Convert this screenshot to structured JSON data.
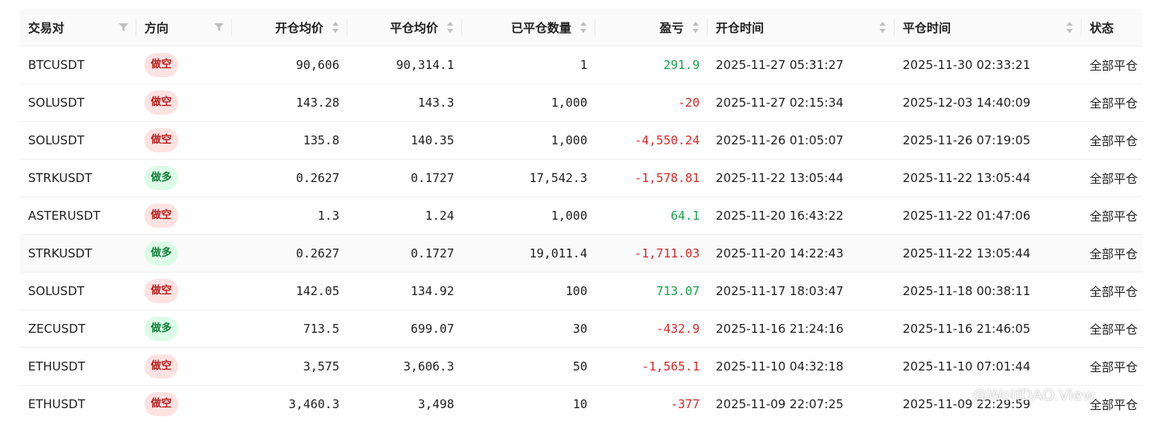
{
  "headers": {
    "pair": "交易对",
    "direction": "方向",
    "open_avg": "开仓均价",
    "close_avg": "平仓均价",
    "closed_qty": "已平仓数量",
    "pnl": "盈亏",
    "open_time": "开仓时间",
    "close_time": "平仓时间",
    "status": "状态"
  },
  "rows": [
    {
      "pair": "BTCUSDT",
      "direction": "做空",
      "side": "short",
      "open_avg": "90,606",
      "close_avg": "90,314.1",
      "closed_qty": "1",
      "pnl": "291.9",
      "pnl_sign": "pos",
      "open_time": "2025-11-27 05:31:27",
      "close_time": "2025-11-30 02:33:21",
      "status": "全部平仓"
    },
    {
      "pair": "SOLUSDT",
      "direction": "做空",
      "side": "short",
      "open_avg": "143.28",
      "close_avg": "143.3",
      "closed_qty": "1,000",
      "pnl": "-20",
      "pnl_sign": "neg",
      "open_time": "2025-11-27 02:15:34",
      "close_time": "2025-12-03 14:40:09",
      "status": "全部平仓"
    },
    {
      "pair": "SOLUSDT",
      "direction": "做空",
      "side": "short",
      "open_avg": "135.8",
      "close_avg": "140.35",
      "closed_qty": "1,000",
      "pnl": "-4,550.24",
      "pnl_sign": "neg",
      "open_time": "2025-11-26 01:05:07",
      "close_time": "2025-11-26 07:19:05",
      "status": "全部平仓"
    },
    {
      "pair": "STRKUSDT",
      "direction": "做多",
      "side": "long",
      "open_avg": "0.2627",
      "close_avg": "0.1727",
      "closed_qty": "17,542.3",
      "pnl": "-1,578.81",
      "pnl_sign": "neg",
      "open_time": "2025-11-22 13:05:44",
      "close_time": "2025-11-22 13:05:44",
      "status": "全部平仓"
    },
    {
      "pair": "ASTERUSDT",
      "direction": "做空",
      "side": "short",
      "open_avg": "1.3",
      "close_avg": "1.24",
      "closed_qty": "1,000",
      "pnl": "64.1",
      "pnl_sign": "pos",
      "open_time": "2025-11-20 16:43:22",
      "close_time": "2025-11-22 01:47:06",
      "status": "全部平仓"
    },
    {
      "pair": "STRKUSDT",
      "direction": "做多",
      "side": "long",
      "open_avg": "0.2627",
      "close_avg": "0.1727",
      "closed_qty": "19,011.4",
      "pnl": "-1,711.03",
      "pnl_sign": "neg",
      "open_time": "2025-11-20 14:22:43",
      "close_time": "2025-11-22 13:05:44",
      "status": "全部平仓",
      "hovered": true
    },
    {
      "pair": "SOLUSDT",
      "direction": "做空",
      "side": "short",
      "open_avg": "142.05",
      "close_avg": "134.92",
      "closed_qty": "100",
      "pnl": "713.07",
      "pnl_sign": "pos",
      "open_time": "2025-11-17 18:03:47",
      "close_time": "2025-11-18 00:38:11",
      "status": "全部平仓"
    },
    {
      "pair": "ZECUSDT",
      "direction": "做多",
      "side": "long",
      "open_avg": "713.5",
      "close_avg": "699.07",
      "closed_qty": "30",
      "pnl": "-432.9",
      "pnl_sign": "neg",
      "open_time": "2025-11-16 21:24:16",
      "close_time": "2025-11-16 21:46:05",
      "status": "全部平仓"
    },
    {
      "pair": "ETHUSDT",
      "direction": "做空",
      "side": "short",
      "open_avg": "3,575",
      "close_avg": "3,606.3",
      "closed_qty": "50",
      "pnl": "-1,565.1",
      "pnl_sign": "neg",
      "open_time": "2025-11-10 04:32:18",
      "close_time": "2025-11-10 07:01:44",
      "status": "全部平仓"
    },
    {
      "pair": "ETHUSDT",
      "direction": "做空",
      "side": "short",
      "open_avg": "3,460.3",
      "close_avg": "3,498",
      "closed_qty": "10",
      "pnl": "-377",
      "pnl_sign": "neg",
      "open_time": "2025-11-09 22:07:25",
      "close_time": "2025-11-09 22:29:59",
      "status": "全部平仓"
    }
  ],
  "watermark": "@WolfDAO.View",
  "colors": {
    "positive": "#16a34a",
    "negative": "#dc2626",
    "short_tag_bg": "#fde2e2",
    "long_tag_bg": "#dcfce7"
  },
  "icons": {
    "filter": "filter-icon",
    "sort": "sort-icon"
  }
}
